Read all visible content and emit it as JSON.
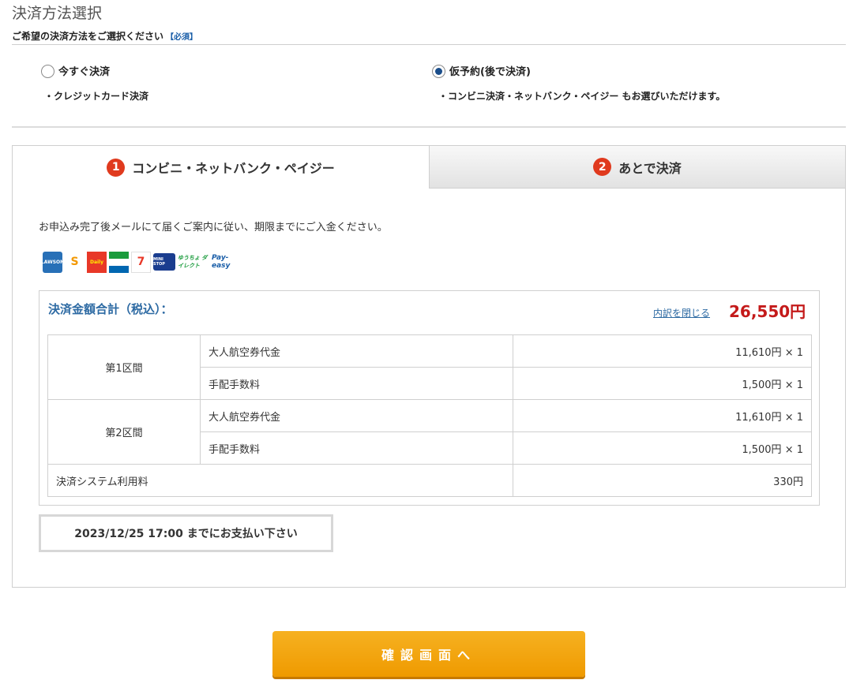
{
  "header": {
    "title": "決済方法選択",
    "subtitle": "ご希望の決済方法をご選択ください",
    "required": "【必須】"
  },
  "options": [
    {
      "label": "今すぐ決済",
      "description": "・クレジットカード決済",
      "selected": false
    },
    {
      "label": "仮予約(後で決済)",
      "description": "・コンビニ決済・ネットバンク・ペイジー もお選びいただけます。",
      "selected": true
    }
  ],
  "tabs": [
    {
      "num": "1",
      "label": "コンビニ・ネットバンク・ペイジー",
      "active": true
    },
    {
      "num": "2",
      "label": "あとで決済",
      "active": false
    }
  ],
  "notice": "お申込み完了後メールにて届くご案内に従い、期限までにご入金ください。",
  "logos": [
    {
      "icon": "lawson-logo",
      "text": "LAWSON"
    },
    {
      "icon": "seicomart-logo",
      "text": "S"
    },
    {
      "icon": "daily-yamazaki-logo",
      "text": "Daily"
    },
    {
      "icon": "familymart-logo",
      "text": ""
    },
    {
      "icon": "seven-eleven-logo",
      "text": "7"
    },
    {
      "icon": "ministop-logo",
      "text": "MINI STOP"
    },
    {
      "icon": "yucho-direct-logo",
      "text": "ゆうちょ ダイレクト"
    },
    {
      "icon": "pay-easy-logo",
      "text": "Pay-easy"
    }
  ],
  "summary": {
    "title": "決済金額合計（税込）：",
    "toggle_link": "内訳を閉じる",
    "total": "26,550円",
    "segments": [
      {
        "name": "第1区間",
        "items": [
          {
            "label": "大人航空券代金",
            "amount": "11,610円 × 1"
          },
          {
            "label": "手配手数料",
            "amount": "1,500円 × 1"
          }
        ]
      },
      {
        "name": "第2区間",
        "items": [
          {
            "label": "大人航空券代金",
            "amount": "11,610円 × 1"
          },
          {
            "label": "手配手数料",
            "amount": "1,500円 × 1"
          }
        ]
      }
    ],
    "system_fee": {
      "label": "決済システム利用料",
      "amount": "330円"
    }
  },
  "due": "2023/12/25 17:00 までにお支払い下さい",
  "confirm_button": "確認画面へ",
  "colors": {
    "accent_blue": "#2d6aa3",
    "total_red": "#c41a1a",
    "button_orange": "#f6a911",
    "tab_number_red": "#e03a1e"
  }
}
